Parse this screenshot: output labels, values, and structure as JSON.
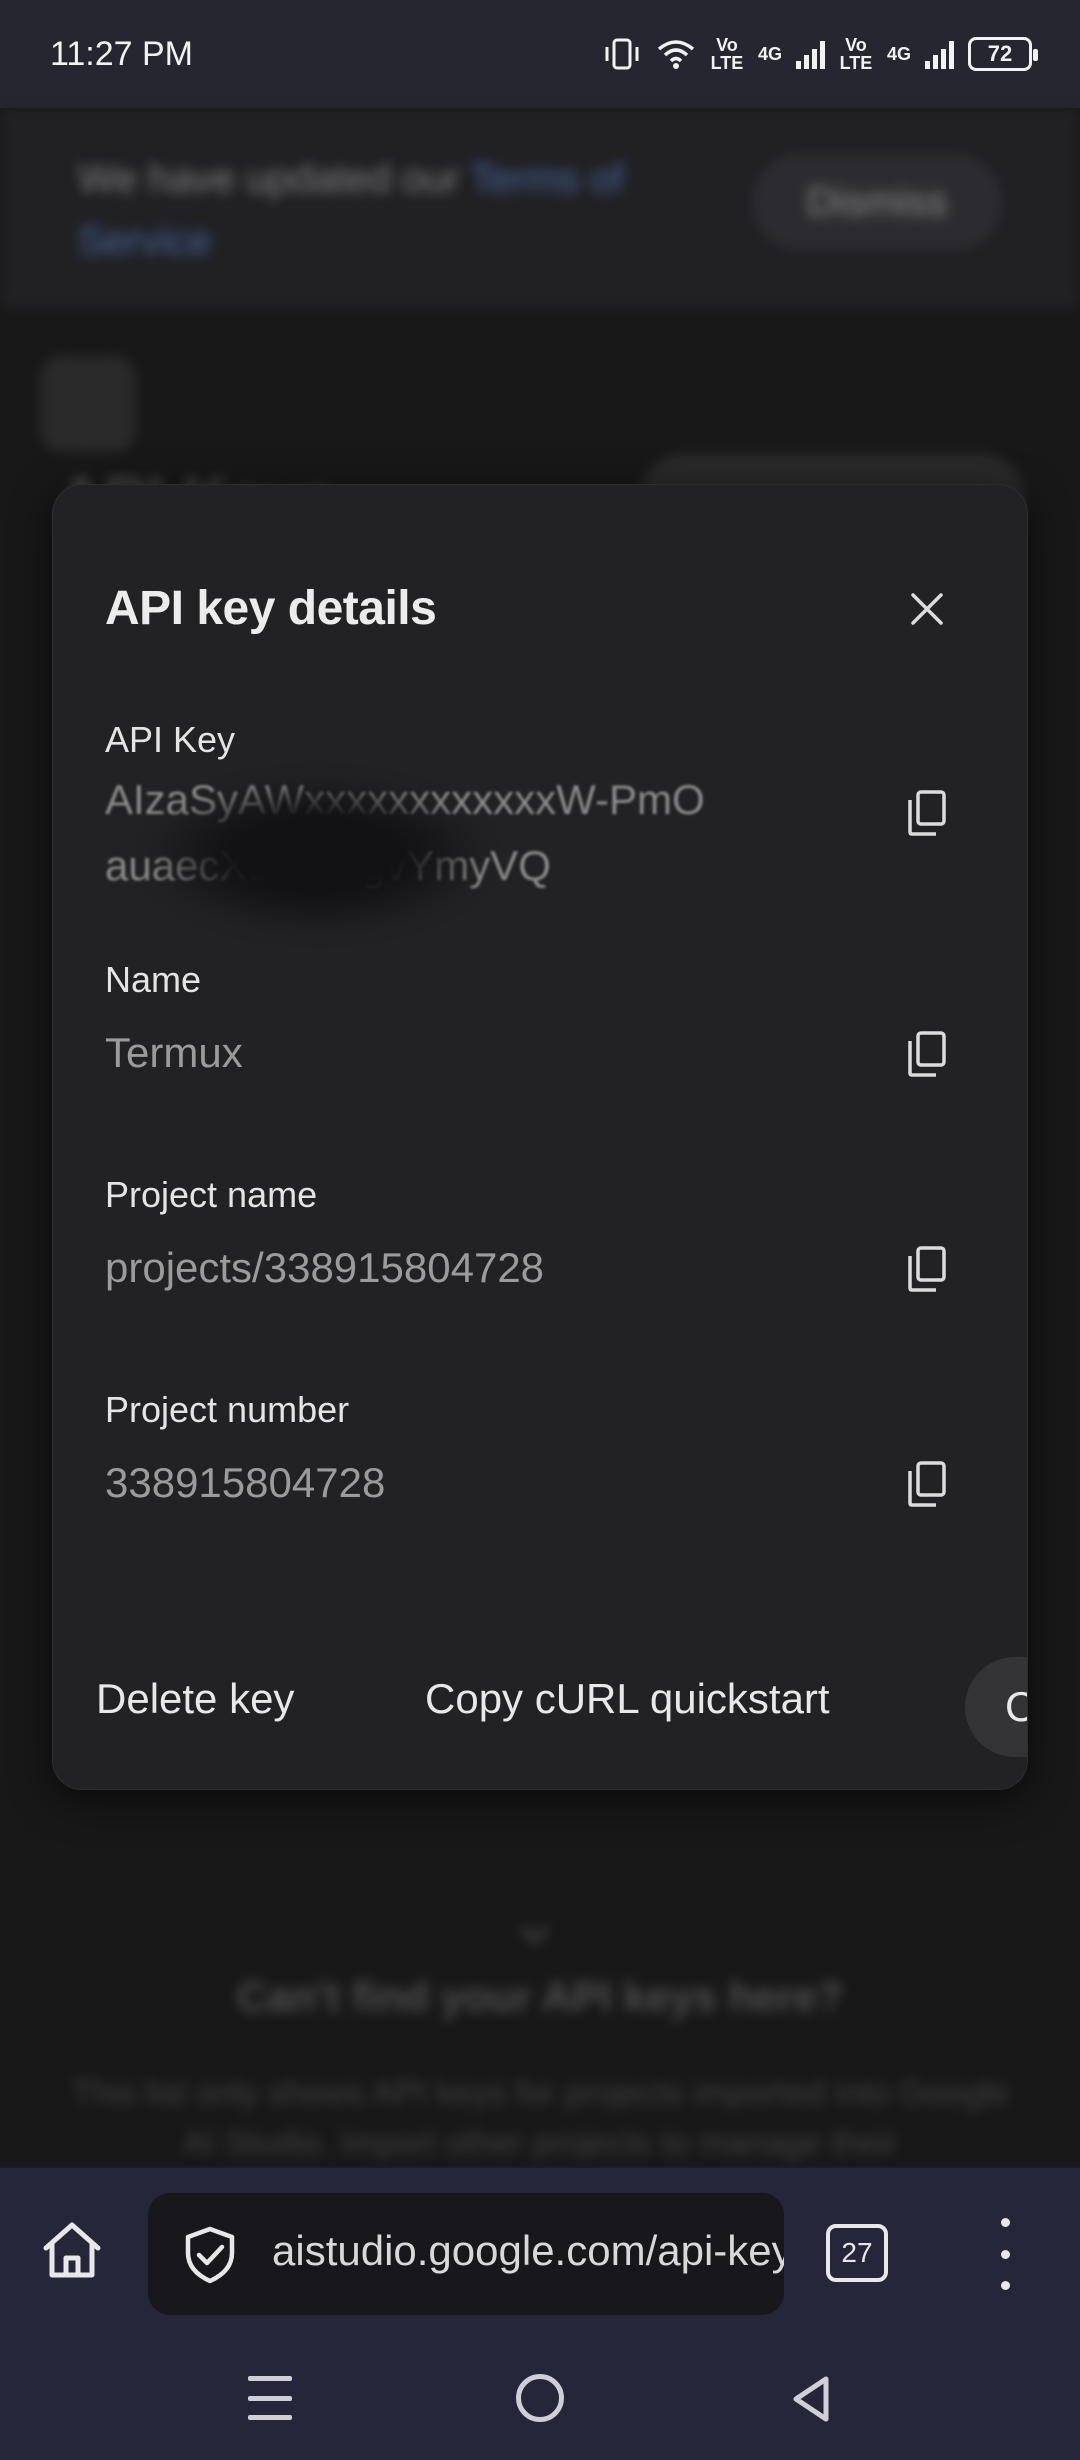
{
  "status_bar": {
    "time": "11:27 PM",
    "volte_1": "Vo LTE",
    "network_1": "4G",
    "volte_2": "Vo LTE",
    "network_2": "4G",
    "battery": "72"
  },
  "background": {
    "banner_text": "We have updated our",
    "banner_link": "Terms of Service",
    "dismiss_label": "Dismiss",
    "heading": "API Keys",
    "cant_find_title": "Can't find your API keys here?",
    "cant_find_desc": "This list only shows API keys for projects imported into Google AI Studio. Import other projects to manage their"
  },
  "dialog": {
    "title": "API key details",
    "fields": [
      {
        "label": "API Key",
        "value": "AIzaSyAWxxxxxxxxxxxxW-PmOauaecXuJJnZgvYmyVQ"
      },
      {
        "label": "Name",
        "value": "Termux"
      },
      {
        "label": "Project name",
        "value": "projects/338915804728"
      },
      {
        "label": "Project number",
        "value": "338915804728"
      }
    ],
    "actions": {
      "delete": "Delete key",
      "copy_curl": "Copy cURL quickstart",
      "third": "C"
    }
  },
  "browser": {
    "url": "aistudio.google.com/api-keys",
    "tab_count": "27"
  }
}
